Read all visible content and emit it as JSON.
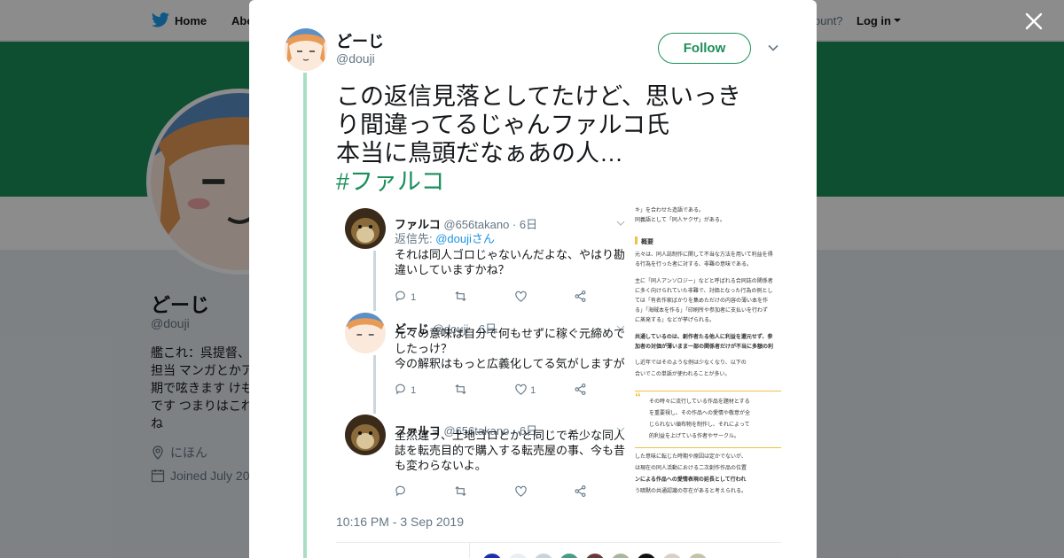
{
  "nav": {
    "home_label": "Home",
    "about_label": "Abo",
    "account_prompt": "ccount?",
    "login_label": "Log in"
  },
  "profile": {
    "name": "どーじ",
    "handle": "@douji",
    "bio_lines": [
      "艦これ：呉提督、",
      "担当 マンガとかア",
      "期で呟きます けも",
      "です つまりはこれ",
      "ね"
    ],
    "location": "にほん",
    "joined": "Joined July 20",
    "banner_color": "#1b8f5a"
  },
  "tweet": {
    "author_name": "どーじ",
    "author_handle": "@douji",
    "follow_label": "Follow",
    "text_lines": [
      "この返信見落としてたけど、思いっき",
      "り間違ってるじゃんファルコ氏",
      "本当に鳥頭だなぁあの人…"
    ],
    "hashtag": "#ファルコ",
    "timestamp": "10:16 PM - 3 Sep 2019",
    "accent_color": "#1b8f5a"
  },
  "media": {
    "replies": [
      {
        "name": "ファルコ",
        "meta": "@656takano · 6日",
        "reply_to_prefix": "返信先: ",
        "reply_to_user": "@doujiさん",
        "lines": [
          "それは同人ゴロじゃないんだよな、やはり勘",
          "違いしていますかね？"
        ],
        "reply_count": "1",
        "retweet_count": "",
        "like_count": ""
      },
      {
        "name": "どーじ",
        "meta": "@douji · 6日",
        "lines": [
          "元々の意味は自分で何もせずに稼ぐ元締めで",
          "したっけ？",
          "今の解釈はもっと広義化してる気がしますが"
        ],
        "reply_count": "1",
        "retweet_count": "",
        "like_count": "1"
      },
      {
        "name": "ファルコ",
        "meta": "@656takano · 6日",
        "lines": [
          "全然違う、土地ゴロとかと同じで希少な同人",
          "誌を転売目的で購入する転売屋の事、今も昔",
          "も変わらないよ。"
        ],
        "reply_count": "",
        "retweet_count": "",
        "like_count": ""
      }
    ],
    "doc": {
      "lines_top": [
        "キ」を合わせた造語である。",
        "同義語として「同人ヤクザ」がある。"
      ],
      "heading": "概要",
      "lines_mid": [
        "元々は、同人誌制作に関して不当な方法を用いて利益を得",
        "る行為を行った者に対する、非難の意味である。",
        "主に「同人アンソロジー」などと呼ばれる合同誌の関係者",
        "に多く向けられていた非難で、対価となった行為の例とし",
        "ては「有名作家ばかりを集めただけの内容の薄い本を作",
        "る」「海賊本を作る」「印刷所や参加者に支払いを行わず",
        "に蒸発する」などが挙げられる。",
        "共通しているのは、創作者たる他人に利益を還元せず、参",
        "加者の対価が薄いまま一部の関係者だけが不当に多額の利",
        "し近年ではそのような例は少なくなり、以下の",
        "合いでこの単語が使われることが多い。"
      ],
      "quote_lines": [
        "その時々に流行している作品を題材とする",
        "を重要視し、その作品への愛情や敬意が全",
        "じられない頒布物を制作し、それによって",
        "的利益を上げている作者やサークル。"
      ],
      "lines_bottom": [
        "した意味に転じた時期や原因は定かでないが、",
        "は現在の同人活動における二次創作作品の位置",
        "ンによる作品への愛情表現の延長として行われ",
        "う暗黙の共通認識の存在があると考えられる。"
      ]
    }
  }
}
